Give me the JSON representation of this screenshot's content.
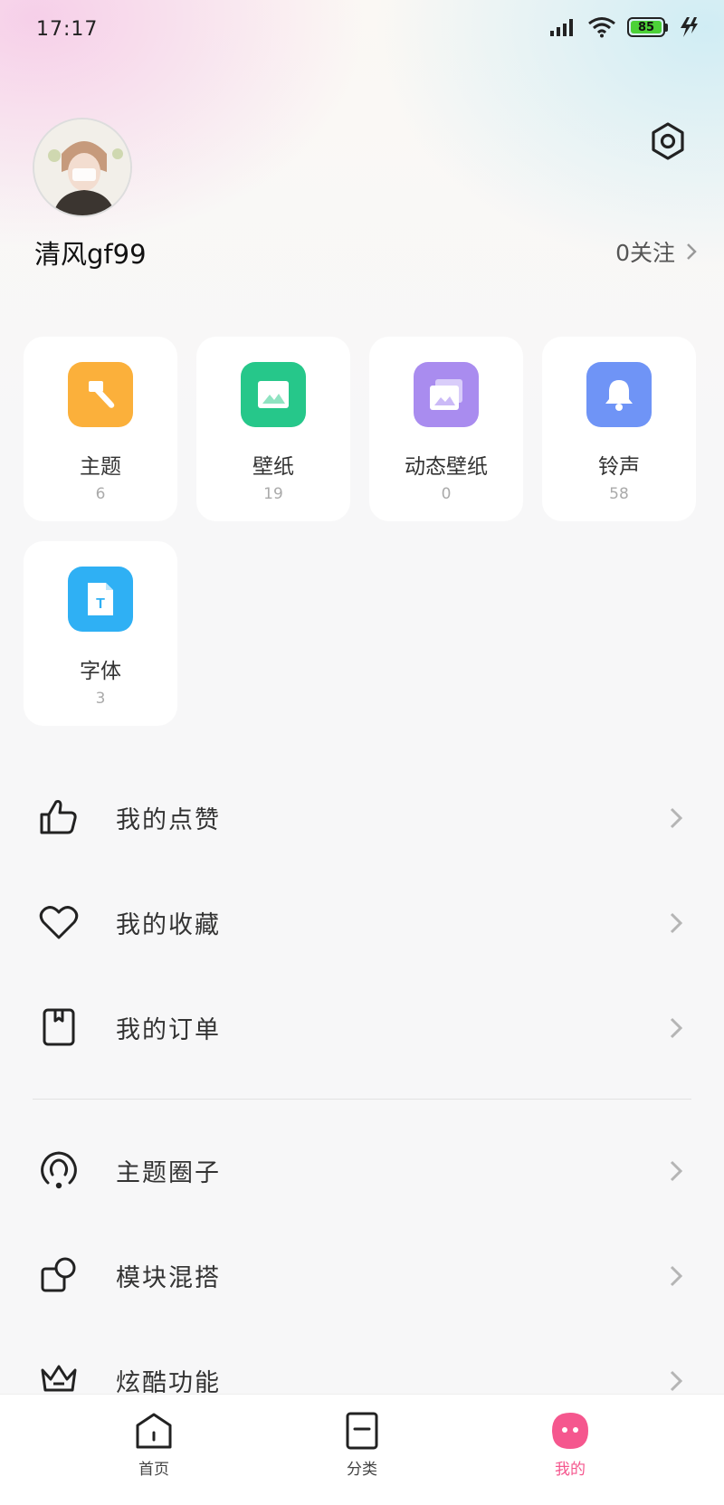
{
  "status_bar": {
    "time": "17:17",
    "battery": "85"
  },
  "profile": {
    "username": "清风gf99",
    "follow_text": "0关注"
  },
  "grid": [
    {
      "label": "主题",
      "count": "6",
      "icon": "brush-icon",
      "color": "#fbb03b"
    },
    {
      "label": "壁纸",
      "count": "19",
      "icon": "picture-icon",
      "color": "#26c78a"
    },
    {
      "label": "动态壁纸",
      "count": "0",
      "icon": "live-wallpaper-icon",
      "color": "#a98cef"
    },
    {
      "label": "铃声",
      "count": "58",
      "icon": "bell-icon",
      "color": "#6f94f6"
    },
    {
      "label": "字体",
      "count": "3",
      "icon": "font-file-icon",
      "color": "#2fb0f4"
    }
  ],
  "menu": [
    {
      "label": "我的点赞",
      "icon": "thumbs-up-icon"
    },
    {
      "label": "我的收藏",
      "icon": "heart-icon"
    },
    {
      "label": "我的订单",
      "icon": "order-icon"
    },
    {
      "label": "主题圈子",
      "icon": "circle-community-icon"
    },
    {
      "label": "模块混搭",
      "icon": "module-mix-icon"
    },
    {
      "label": "炫酷功能",
      "icon": "crown-icon"
    }
  ],
  "bottom_nav": [
    {
      "label": "首页",
      "icon": "home-icon"
    },
    {
      "label": "分类",
      "icon": "category-icon"
    },
    {
      "label": "我的",
      "icon": "me-icon",
      "active": true,
      "color": "#f5578e"
    }
  ]
}
